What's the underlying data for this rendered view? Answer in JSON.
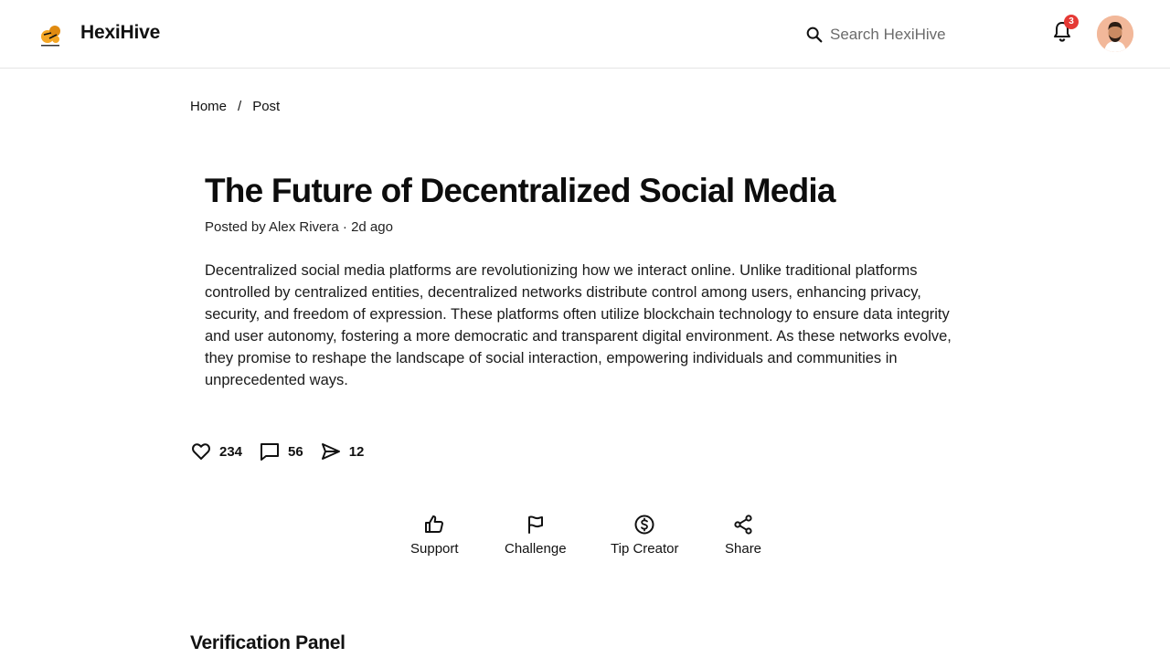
{
  "header": {
    "brand": "HexiHive",
    "search": {
      "placeholder": "Search HexiHive",
      "value": ""
    },
    "notifications": {
      "count": "3"
    },
    "icons": {
      "logo": "hexihive-logo",
      "search": "search-icon",
      "bell": "bell-icon",
      "avatar": "user-avatar"
    }
  },
  "breadcrumb": {
    "home": "Home",
    "separator": "/",
    "current": "Post"
  },
  "post": {
    "title": "The Future of Decentralized Social Media",
    "meta": "Posted by Alex Rivera · 2d ago",
    "body": "Decentralized social media platforms are revolutionizing how we interact online. Unlike traditional platforms controlled by centralized entities, decentralized networks distribute control among users, enhancing privacy, security, and freedom of expression. These platforms often utilize blockchain technology to ensure data integrity and user autonomy, fostering a more democratic and transparent digital environment. As these networks evolve, they promise to reshape the landscape of social interaction, empowering individuals and communities in unprecedented ways."
  },
  "stats": {
    "likes": "234",
    "comments": "56",
    "shares": "12"
  },
  "actions": {
    "support": "Support",
    "challenge": "Challenge",
    "tip": "Tip Creator",
    "share": "Share"
  },
  "sections": {
    "verification_title": "Verification Panel"
  },
  "colors": {
    "badge": "#e53935",
    "avatar_bg": "#f2b89a",
    "logo_accent": "#f5a623",
    "divider": "#e5e5e5"
  }
}
